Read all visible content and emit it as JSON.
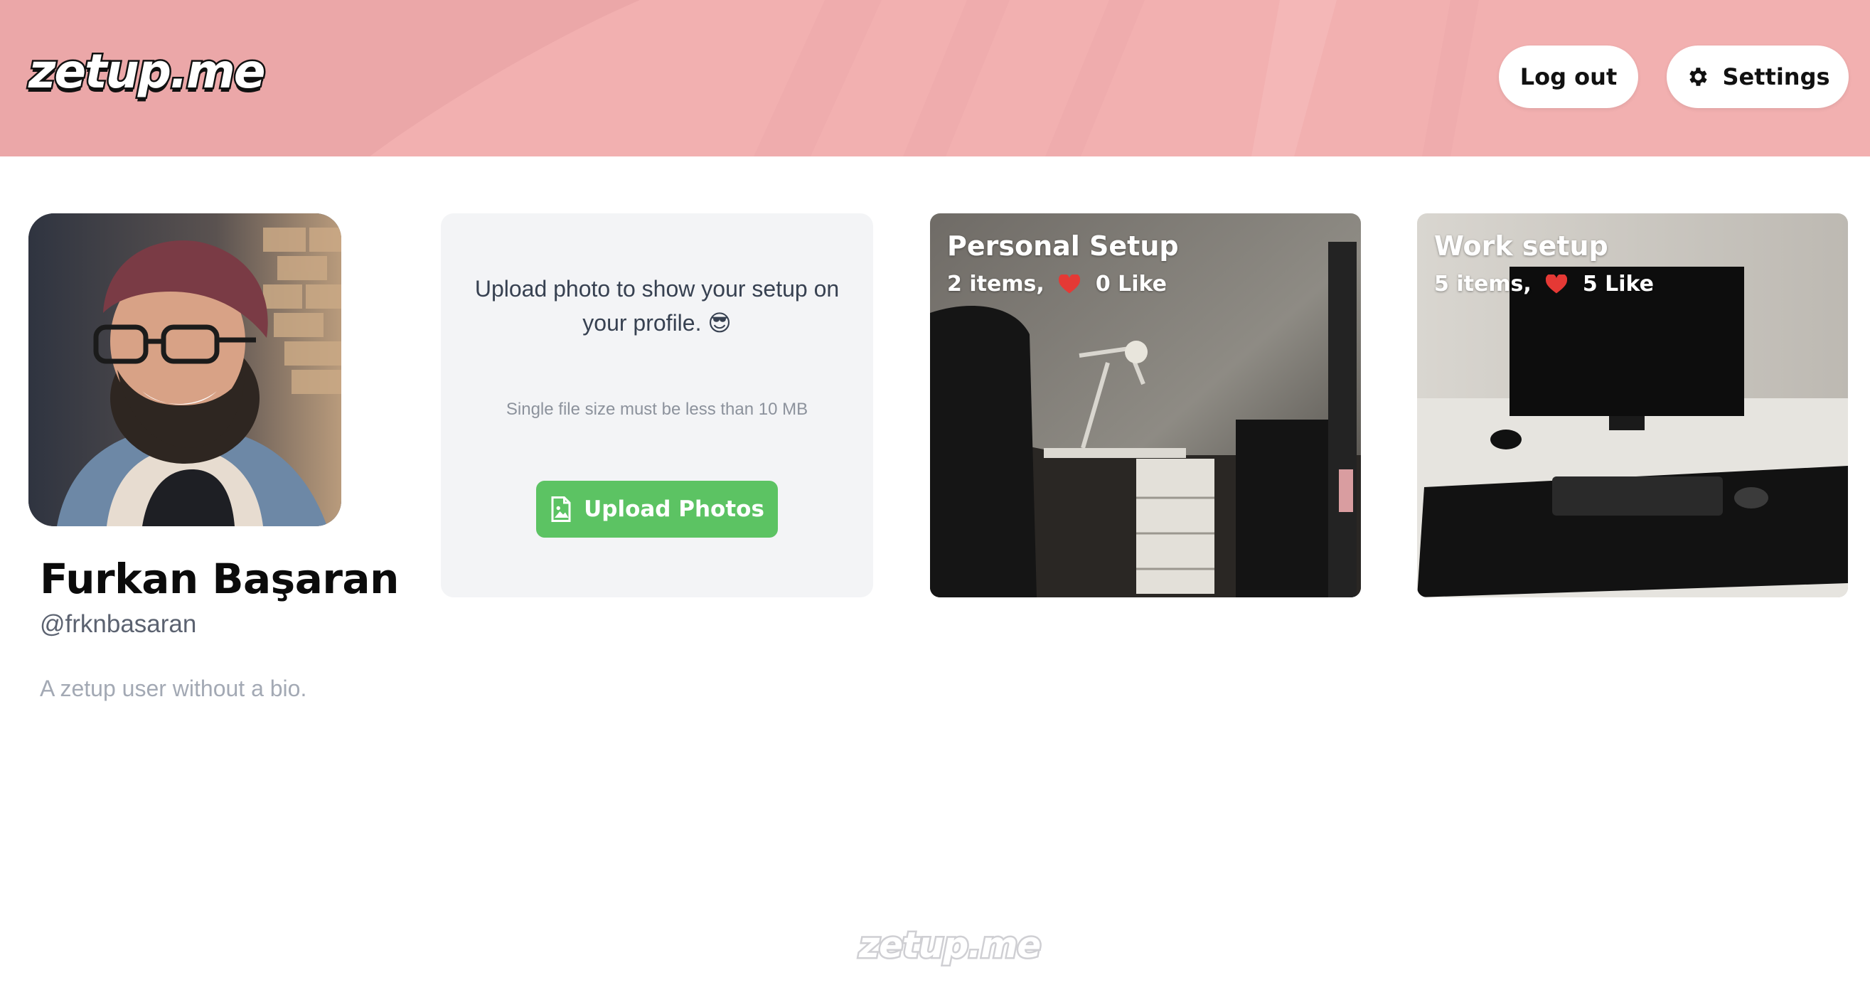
{
  "brand": {
    "logo_text": "zetup.me"
  },
  "header": {
    "background_color": "#f2b0b0",
    "logout_label": "Log out",
    "settings_label": "Settings",
    "settings_icon": "gear-icon"
  },
  "profile": {
    "name": "Furkan Başaran",
    "handle": "@frknbasaran",
    "bio": "A zetup user without a bio."
  },
  "upload": {
    "message": "Upload photo to show your setup on your profile. 😎",
    "note": "Single file size must be less than 10 MB",
    "button_label": "Upload Photos",
    "button_color": "#5cc363",
    "button_icon": "image-file-icon"
  },
  "setups": [
    {
      "title": "Personal Setup",
      "items_text": "2 items,",
      "likes_text": "0 Like"
    },
    {
      "title": "Work setup",
      "items_text": "5 items,",
      "likes_text": "5 Like"
    }
  ],
  "footer": {
    "logo_text": "zetup.me"
  },
  "colors": {
    "heart": "#e53935",
    "accent_green": "#5cc363"
  }
}
